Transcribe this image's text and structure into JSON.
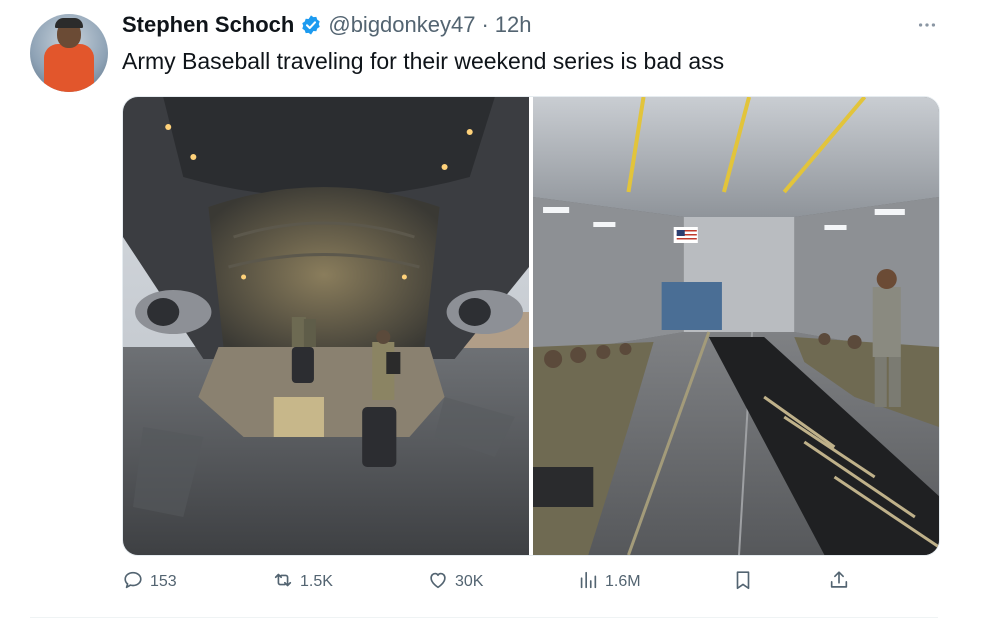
{
  "author": {
    "name": "Stephen Schoch",
    "handle": "@bigdonkey47",
    "separator": "·",
    "time": "12h",
    "verified": true
  },
  "tweet": {
    "text": "Army Baseball traveling for their weekend series is bad ass"
  },
  "media": {
    "photos": [
      "aircraft-cargo-ramp-photo",
      "aircraft-cabin-photo"
    ]
  },
  "actions": {
    "replies": "153",
    "retweets": "1.5K",
    "likes": "30K",
    "views": "1.6M"
  },
  "colors": {
    "verified_blue": "#1d9bf0",
    "secondary_text": "#536471"
  }
}
